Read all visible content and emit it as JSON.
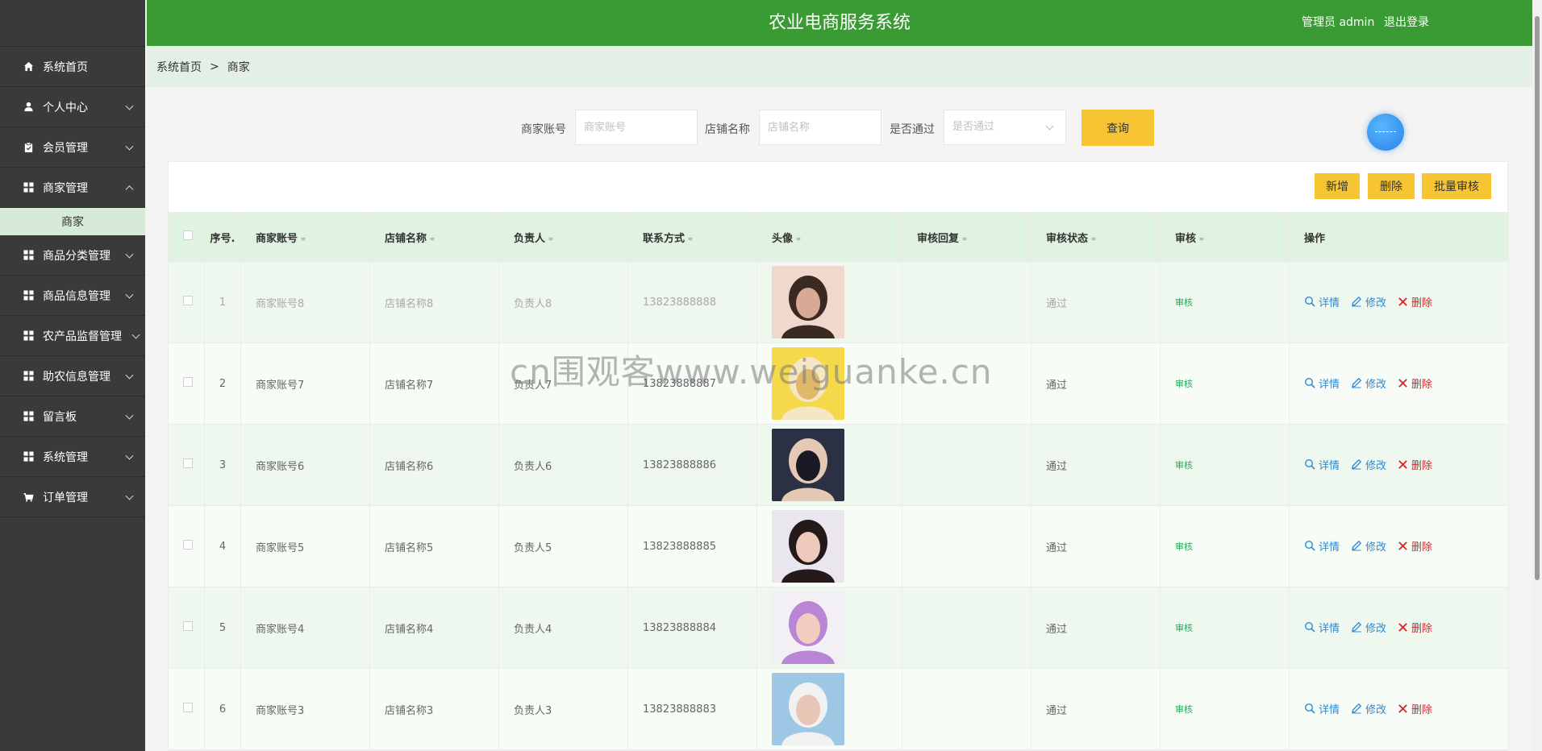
{
  "header": {
    "title": "农业电商服务系统",
    "user": "管理员 admin",
    "logout": "退出登录"
  },
  "sidebar": {
    "items": [
      {
        "label": "系统首页",
        "icon": "home-icon"
      },
      {
        "label": "个人中心",
        "icon": "user-icon"
      },
      {
        "label": "会员管理",
        "icon": "clipboard-icon"
      },
      {
        "label": "商家管理",
        "icon": "grid-icon",
        "expanded": true
      },
      {
        "label": "商品分类管理",
        "icon": "grid-icon"
      },
      {
        "label": "商品信息管理",
        "icon": "grid-icon"
      },
      {
        "label": "农产品监督管理",
        "icon": "grid-icon"
      },
      {
        "label": "助农信息管理",
        "icon": "grid-icon"
      },
      {
        "label": "留言板",
        "icon": "grid-icon"
      },
      {
        "label": "系统管理",
        "icon": "grid-icon"
      },
      {
        "label": "订单管理",
        "icon": "cart-icon"
      }
    ],
    "submenu": {
      "label": "商家"
    }
  },
  "breadcrumb": {
    "home": "系统首页",
    "sep": ">",
    "current": "商家"
  },
  "search": {
    "account_label": "商家账号",
    "account_placeholder": "商家账号",
    "shop_label": "店铺名称",
    "shop_placeholder": "店铺名称",
    "pass_label": "是否通过",
    "pass_placeholder": "是否通过",
    "query_button": "查询"
  },
  "toolbar": {
    "add": "新增",
    "delete": "删除",
    "batch_audit": "批量审核"
  },
  "table": {
    "headers": [
      "序号.",
      "商家账号",
      "店铺名称",
      "负责人",
      "联系方式",
      "头像",
      "审核回复",
      "审核状态",
      "审核",
      "操作"
    ],
    "rows": [
      {
        "idx": "1",
        "account": "商家账号8",
        "shop": "店铺名称8",
        "owner": "负责人8",
        "phone": "13823888888",
        "reply": "",
        "status": "通过",
        "audit": "审核"
      },
      {
        "idx": "2",
        "account": "商家账号7",
        "shop": "店铺名称7",
        "owner": "负责人7",
        "phone": "13823888887",
        "reply": "",
        "status": "通过",
        "audit": "审核"
      },
      {
        "idx": "3",
        "account": "商家账号6",
        "shop": "店铺名称6",
        "owner": "负责人6",
        "phone": "13823888886",
        "reply": "",
        "status": "通过",
        "audit": "审核"
      },
      {
        "idx": "4",
        "account": "商家账号5",
        "shop": "店铺名称5",
        "owner": "负责人5",
        "phone": "13823888885",
        "reply": "",
        "status": "通过",
        "audit": "审核"
      },
      {
        "idx": "5",
        "account": "商家账号4",
        "shop": "店铺名称4",
        "owner": "负责人4",
        "phone": "13823888884",
        "reply": "",
        "status": "通过",
        "audit": "审核"
      },
      {
        "idx": "6",
        "account": "商家账号3",
        "shop": "店铺名称3",
        "owner": "负责人3",
        "phone": "13823888883",
        "reply": "",
        "status": "通过",
        "audit": "审核"
      }
    ],
    "actions": {
      "detail": "详情",
      "edit": "修改",
      "delete": "删除"
    }
  },
  "watermark": "cn围观客www.weiguanke.cn",
  "colors": {
    "header_green": "#3a9a33",
    "sidebar_dark": "#3a3a3a",
    "button_yellow": "#f7c531",
    "action_blue": "#2a8ad8",
    "action_red": "#d9262a"
  }
}
